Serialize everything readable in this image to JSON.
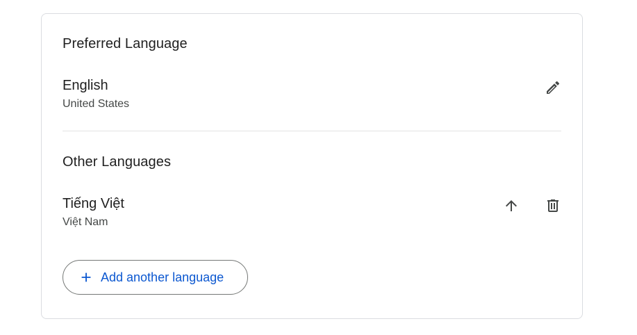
{
  "preferred": {
    "title": "Preferred Language",
    "language": "English",
    "region": "United States",
    "edit_icon": "pencil-icon"
  },
  "other": {
    "title": "Other Languages",
    "items": [
      {
        "language": "Tiếng Việt",
        "region": "Việt Nam",
        "move_icon": "arrow-up-icon",
        "delete_icon": "trash-icon"
      }
    ]
  },
  "add_button": {
    "label": "Add another language",
    "icon": "plus-icon"
  },
  "colors": {
    "accent": "#0b57d0",
    "text": "#1f1f1f",
    "secondary_text": "#444746",
    "border": "#dadce0"
  }
}
